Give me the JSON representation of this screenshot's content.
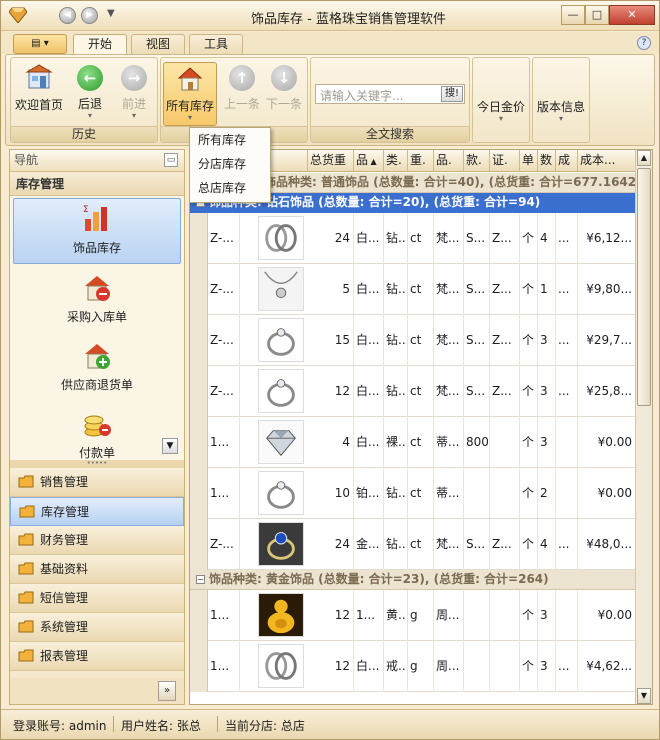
{
  "window": {
    "title": "饰品库存 - 蓝格珠宝销售管理软件"
  },
  "ribbon_tabs": [
    "开始",
    "视图",
    "工具"
  ],
  "ribbon": {
    "groups": {
      "history": "历史",
      "navigate": "航",
      "search": "全文搜索"
    },
    "buttons": {
      "welcome": "欢迎首页",
      "back": "后退",
      "forward": "前进",
      "all_stock": "所有库存",
      "prev": "上一条",
      "next": "下一条",
      "gold_price": "今日金价",
      "version": "版本信息"
    },
    "search": {
      "placeholder": "请输入关键字...",
      "button": "搜!"
    }
  },
  "dropdown": [
    "所有库存",
    "分店库存",
    "总店库存"
  ],
  "nav": {
    "header": "导航",
    "group_title": "库存管理",
    "items": [
      "饰品库存",
      "采购入库单",
      "供应商退货单",
      "付款单"
    ],
    "modules": [
      "销售管理",
      "库存管理",
      "财务管理",
      "基础资料",
      "短信管理",
      "系统管理",
      "报表管理"
    ]
  },
  "grid": {
    "columns": [
      "片",
      "总货重",
      "品",
      "类.",
      "重.",
      "品.",
      "款.",
      "证.",
      "单",
      "数",
      "成",
      "成本..."
    ],
    "groups": {
      "normal": "饰品种类: 普通饰品 (总数量: 合计=40), (总货重: 合计=677.1642)",
      "diamond": "饰品种类: 钻石饰品 (总数量: 合计=20), (总货重: 合计=94)",
      "gold": "饰品种类: 黄金饰品 (总数量: 合计=23), (总货重: 合计=264)"
    },
    "rows": [
      {
        "code": "Z-...",
        "thumb": "ring-pair",
        "weight": "24",
        "c1": "白...",
        "c2": "钻...",
        "c3": "ct",
        "c4": "梵...",
        "c5": "S...",
        "c6": "Z...",
        "c7": "个",
        "c8": "4",
        "c9": "...",
        "cost": "¥6,12..."
      },
      {
        "code": "Z-...",
        "thumb": "pendant",
        "weight": "5",
        "c1": "白...",
        "c2": "钻...",
        "c3": "ct",
        "c4": "梵...",
        "c5": "S...",
        "c6": "Z...",
        "c7": "个",
        "c8": "1",
        "c9": "...",
        "cost": "¥9,80..."
      },
      {
        "code": "Z-...",
        "thumb": "ring",
        "weight": "15",
        "c1": "白...",
        "c2": "钻...",
        "c3": "ct",
        "c4": "梵...",
        "c5": "S...",
        "c6": "Z...",
        "c7": "个",
        "c8": "3",
        "c9": "...",
        "cost": "¥29,7..."
      },
      {
        "code": "Z-...",
        "thumb": "ring-diamond",
        "weight": "12",
        "c1": "白...",
        "c2": "钻...",
        "c3": "ct",
        "c4": "梵...",
        "c5": "S...",
        "c6": "Z...",
        "c7": "个",
        "c8": "3",
        "c9": "...",
        "cost": "¥25,8..."
      },
      {
        "code": "1...",
        "thumb": "loose-diamond",
        "weight": "4",
        "c1": "白...",
        "c2": "裸...",
        "c3": "ct",
        "c4": "蒂...",
        "c5": "800",
        "c6": "",
        "c7": "个",
        "c8": "3",
        "c9": "",
        "cost": "¥0.00"
      },
      {
        "code": "1...",
        "thumb": "ring-band",
        "weight": "10",
        "c1": "铂...",
        "c2": "钻...",
        "c3": "ct",
        "c4": "蒂...",
        "c5": "",
        "c6": "",
        "c7": "个",
        "c8": "2",
        "c9": "",
        "cost": "¥0.00"
      },
      {
        "code": "Z-...",
        "thumb": "ring-sapphire",
        "weight": "24",
        "c1": "金...",
        "c2": "钻...",
        "c3": "ct",
        "c4": "梵...",
        "c5": "S...",
        "c6": "Z...",
        "c7": "个",
        "c8": "4",
        "c9": "...",
        "cost": "¥48,0..."
      },
      {
        "code": "1...",
        "thumb": "gold-buddha",
        "weight": "12",
        "c1": "1...",
        "c2": "黄...",
        "c3": "g",
        "c4": "周...",
        "c5": "",
        "c6": "",
        "c7": "个",
        "c8": "3",
        "c9": "",
        "cost": "¥0.00"
      },
      {
        "code": "1...",
        "thumb": "ring-pair",
        "weight": "12",
        "c1": "白...",
        "c2": "戒...",
        "c3": "g",
        "c4": "周...",
        "c5": "",
        "c6": "",
        "c7": "个",
        "c8": "3",
        "c9": "...",
        "cost": "¥4,62..."
      }
    ]
  },
  "status": {
    "login": "登录账号: admin",
    "user": "用户姓名: 张总",
    "branch": "当前分店: 总店"
  },
  "colors": {
    "selection": "#3a6fd0",
    "ribbon_bg": "#f1e3c2",
    "nav_selected": "#b9d3f3"
  }
}
